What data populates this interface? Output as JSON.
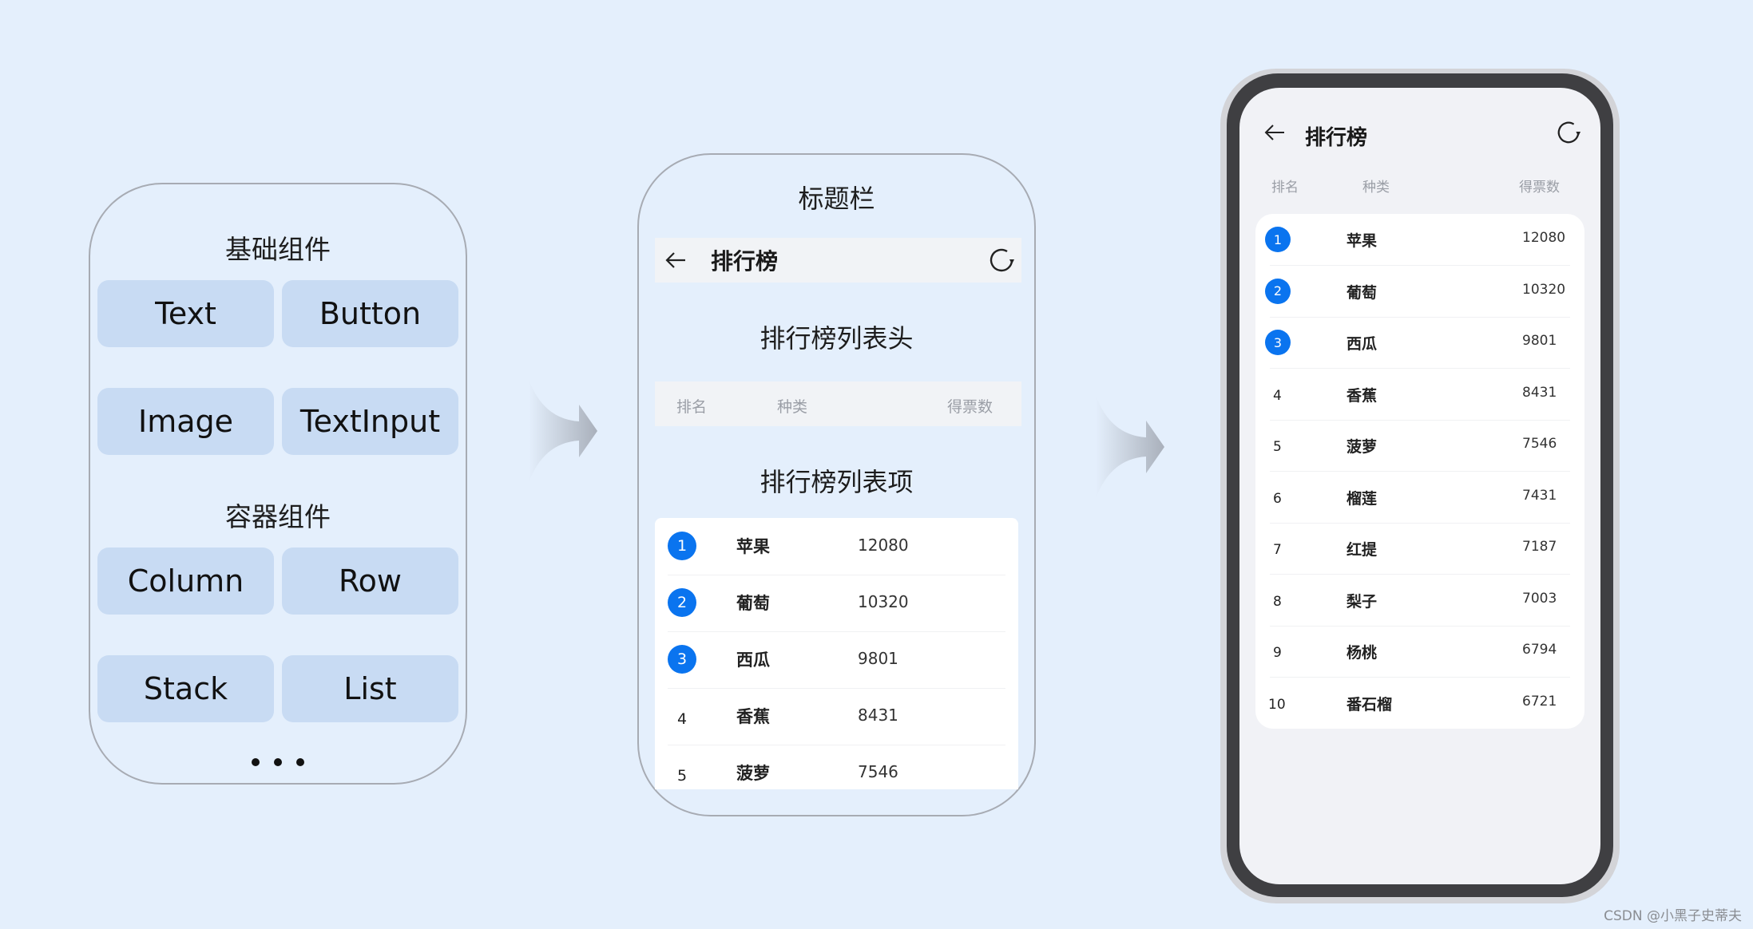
{
  "left_panel": {
    "basic_title": "基础组件",
    "basic_components": [
      "Text",
      "Button",
      "Image",
      "TextInput"
    ],
    "container_title": "容器组件",
    "container_components": [
      "Column",
      "Row",
      "Stack",
      "List"
    ],
    "more_indicator": "..."
  },
  "middle_panel": {
    "titlebar_label": "标题栏",
    "titlebar": {
      "back_icon": "arrow-left-icon",
      "title": "排行榜",
      "refresh_icon": "refresh-icon"
    },
    "header_label": "排行榜列表头",
    "header": {
      "rank": "排名",
      "type": "种类",
      "votes": "得票数"
    },
    "items_label": "排行榜列表项",
    "items": [
      {
        "rank": "1",
        "name": "苹果",
        "votes": "12080",
        "highlight": true
      },
      {
        "rank": "2",
        "name": "葡萄",
        "votes": "10320",
        "highlight": true
      },
      {
        "rank": "3",
        "name": "西瓜",
        "votes": "9801",
        "highlight": true
      },
      {
        "rank": "4",
        "name": "香蕉",
        "votes": "8431",
        "highlight": false
      },
      {
        "rank": "5",
        "name": "菠萝",
        "votes": "7546",
        "highlight": false
      }
    ]
  },
  "phone": {
    "title": "排行榜",
    "back_icon": "arrow-left-icon",
    "refresh_icon": "refresh-icon",
    "header": {
      "rank": "排名",
      "type": "种类",
      "votes": "得票数"
    },
    "items": [
      {
        "rank": "1",
        "name": "苹果",
        "votes": "12080",
        "highlight": true
      },
      {
        "rank": "2",
        "name": "葡萄",
        "votes": "10320",
        "highlight": true
      },
      {
        "rank": "3",
        "name": "西瓜",
        "votes": "9801",
        "highlight": true
      },
      {
        "rank": "4",
        "name": "香蕉",
        "votes": "8431",
        "highlight": false
      },
      {
        "rank": "5",
        "name": "菠萝",
        "votes": "7546",
        "highlight": false
      },
      {
        "rank": "6",
        "name": "榴莲",
        "votes": "7431",
        "highlight": false
      },
      {
        "rank": "7",
        "name": "红提",
        "votes": "7187",
        "highlight": false
      },
      {
        "rank": "8",
        "name": "梨子",
        "votes": "7003",
        "highlight": false
      },
      {
        "rank": "9",
        "name": "杨桃",
        "votes": "6794",
        "highlight": false
      },
      {
        "rank": "10",
        "name": "番石榴",
        "votes": "6721",
        "highlight": false
      }
    ]
  },
  "colors": {
    "badge": "#0a74ef",
    "chip": "#c8dbf3",
    "background": "#e4effc"
  },
  "watermark": "CSDN @小黑子史蒂夫"
}
